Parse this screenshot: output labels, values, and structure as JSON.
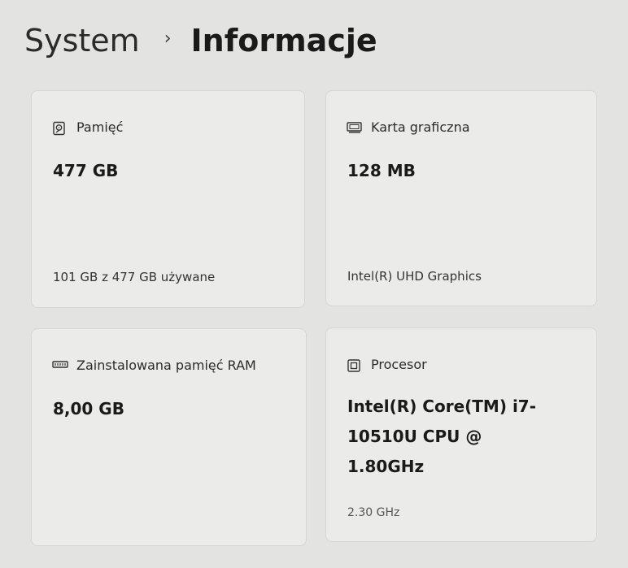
{
  "breadcrumb": {
    "parent": "System",
    "separator": "›",
    "current": "Informacje"
  },
  "cards": [
    {
      "icon": "storage-icon",
      "title": "Pamięć",
      "value": "477 GB",
      "footer": "101 GB z 477 GB używane"
    },
    {
      "icon": "display-adapter-icon",
      "title": "Karta graficzna",
      "value": "128 MB",
      "footer": "Intel(R) UHD Graphics"
    },
    {
      "icon": "ram-icon",
      "title": "Zainstalowana pamięć RAM",
      "value": "8,00 GB",
      "footer": ""
    },
    {
      "icon": "processor-icon",
      "title": "Procesor",
      "value": "Intel(R) Core(TM) i7-10510U CPU @ 1.80GHz",
      "footer": "2.30 GHz"
    }
  ]
}
